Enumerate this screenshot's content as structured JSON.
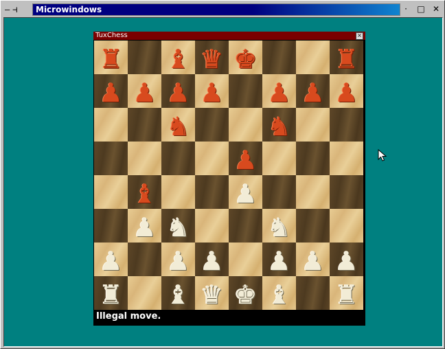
{
  "window": {
    "title": "Microwindows",
    "controls": {
      "minimize": "—",
      "pin": "⊣",
      "menu_dot": "·",
      "maximize": "□",
      "close": "✕"
    },
    "desktop_color": "#008080"
  },
  "chess": {
    "title": "TuxChess",
    "close": "×",
    "status": "Illegal move.",
    "colors": {
      "red": "#d84a1e",
      "white": "#f2ecd6"
    },
    "board": [
      [
        "rook-red",
        "",
        "bishop-red",
        "queen-red",
        "king-red",
        "",
        "",
        "rook-red"
      ],
      [
        "pawn-red",
        "pawn-red",
        "pawn-red",
        "pawn-red",
        "",
        "pawn-red",
        "pawn-red",
        "pawn-red"
      ],
      [
        "",
        "",
        "knight-red",
        "",
        "",
        "knight-red",
        "",
        ""
      ],
      [
        "",
        "",
        "",
        "",
        "pawn-red",
        "",
        "",
        ""
      ],
      [
        "",
        "bishop-red",
        "",
        "",
        "pawn-white",
        "",
        "",
        ""
      ],
      [
        "",
        "pawn-white",
        "knight-white",
        "",
        "",
        "knight-white",
        "",
        ""
      ],
      [
        "pawn-white",
        "",
        "pawn-white",
        "pawn-white",
        "",
        "pawn-white",
        "pawn-white",
        "pawn-white"
      ],
      [
        "rook-white",
        "",
        "bishop-white",
        "queen-white",
        "king-white",
        "bishop-white",
        "",
        "rook-white"
      ]
    ]
  }
}
